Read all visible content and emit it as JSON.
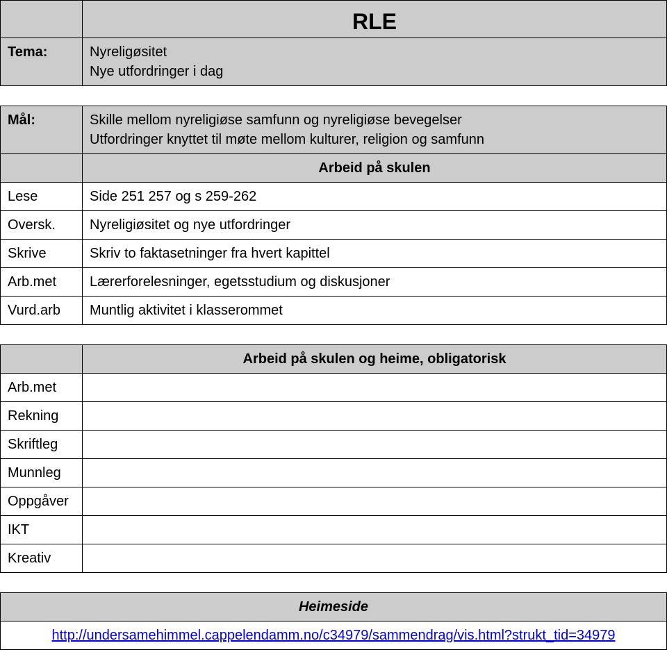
{
  "header": {
    "title": "RLE",
    "tema_label": "Tema:",
    "tema_line1": "Nyreligøsitet",
    "tema_line2": "Nye utfordringer i dag"
  },
  "mal": {
    "label": "Mål:",
    "line1": "Skille mellom nyreligiøse samfunn og nyreligiøse bevegelser",
    "line2": "Utfordringer knyttet til møte mellom kulturer, religion og samfunn"
  },
  "section1": {
    "heading": "Arbeid på skulen",
    "lese_label": "Lese",
    "lese_value": "Side 251 257  og s 259-262",
    "oversk_label": "Oversk.",
    "oversk_value": "Nyreligiøsitet og nye utfordringer",
    "skrive_label": "Skrive",
    "skrive_value": "Skriv to faktasetninger fra hvert kapittel",
    "arbmet_label": "Arb.met",
    "arbmet_value": "Lærerforelesninger, egetsstudium og diskusjoner",
    "vurdarb_label": "Vurd.arb",
    "vurdarb_value": "Muntlig aktivitet i klasserommet"
  },
  "section2": {
    "heading": "Arbeid på skulen og heime, obligatorisk",
    "arbmet_label": "Arb.met",
    "rekning_label": "Rekning",
    "skriftleg_label": "Skriftleg",
    "munnleg_label": "Munnleg",
    "oppgaver_label": "Oppgåver",
    "ikt_label": "IKT",
    "kreativ_label": "Kreativ"
  },
  "footer": {
    "heading": "Heimeside",
    "link_text": "http://undersamehimmel.cappelendamm.no/c34979/sammendrag/vis.html?strukt_tid=34979"
  }
}
